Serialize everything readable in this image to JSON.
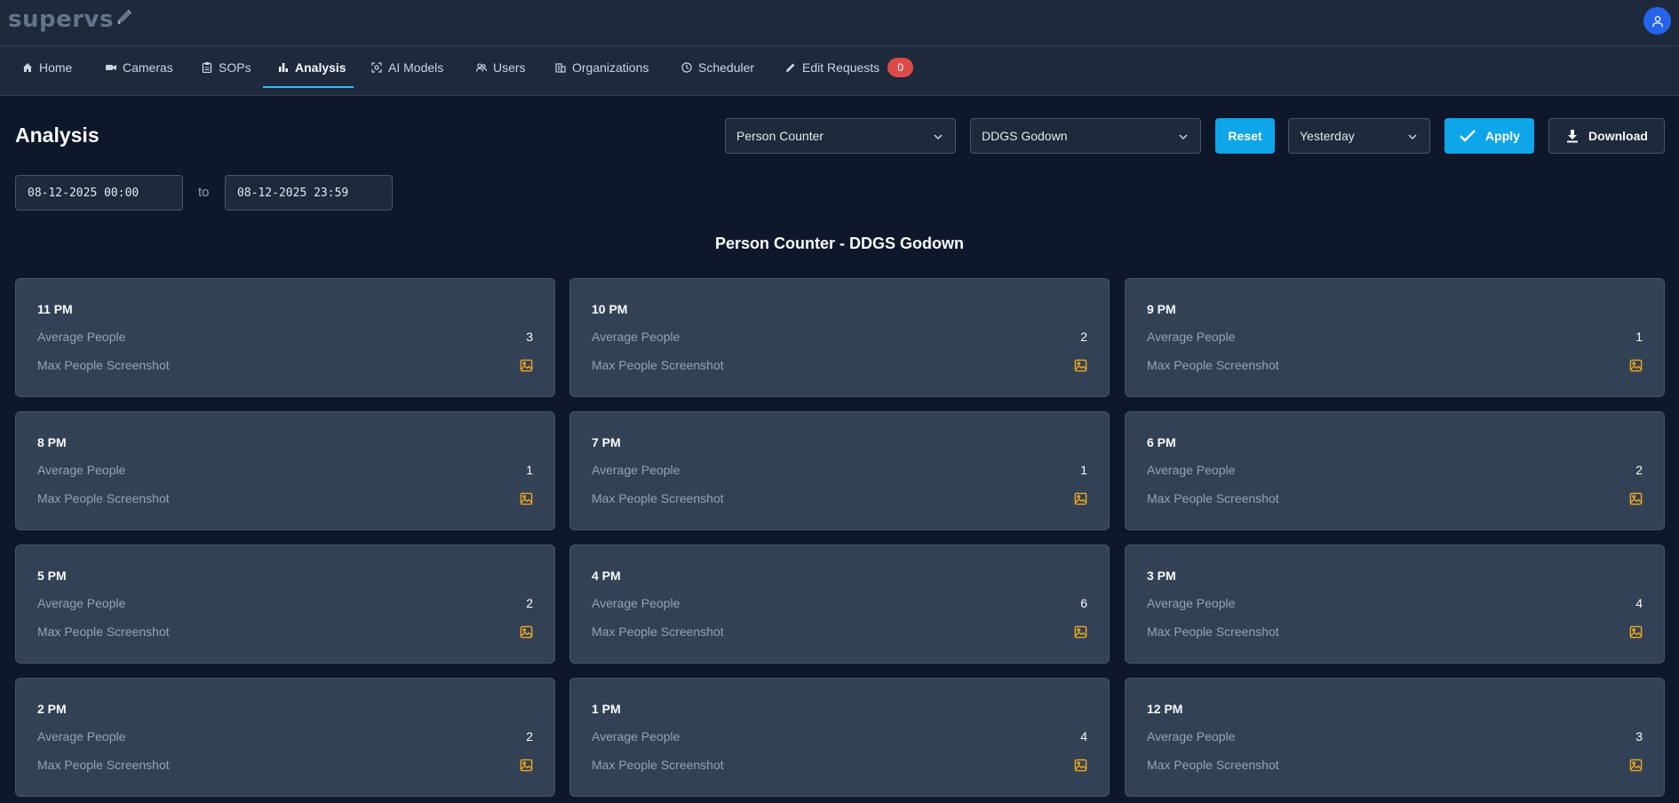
{
  "app": {
    "logo_text": "supervs"
  },
  "nav": {
    "items": [
      {
        "label": "Home",
        "icon": "home-icon"
      },
      {
        "label": "Cameras",
        "icon": "video-camera-icon"
      },
      {
        "label": "SOPs",
        "icon": "clipboard-icon"
      },
      {
        "label": "Analysis",
        "icon": "bar-chart-icon",
        "active": true
      },
      {
        "label": "AI Models",
        "icon": "scan-icon"
      },
      {
        "label": "Users",
        "icon": "users-icon"
      },
      {
        "label": "Organizations",
        "icon": "building-icon"
      },
      {
        "label": "Scheduler",
        "icon": "clock-icon"
      },
      {
        "label": "Edit Requests",
        "icon": "pencil-icon",
        "badge": "0"
      }
    ]
  },
  "page": {
    "title": "Analysis",
    "report_title": "Person Counter - DDGS Godown"
  },
  "filters": {
    "model_select": "Person Counter",
    "location_select": "DDGS Godown",
    "reset_label": "Reset",
    "range_select": "Yesterday",
    "apply_label": "Apply",
    "download_label": "Download",
    "date_from": "08-12-2025 00:00",
    "date_to": "08-12-2025 23:59",
    "to_label": "to"
  },
  "card_labels": {
    "average": "Average People",
    "screenshot": "Max People Screenshot"
  },
  "cards": [
    {
      "hour": "11 PM",
      "average": "3"
    },
    {
      "hour": "10 PM",
      "average": "2"
    },
    {
      "hour": "9 PM",
      "average": "1"
    },
    {
      "hour": "8 PM",
      "average": "1"
    },
    {
      "hour": "7 PM",
      "average": "1"
    },
    {
      "hour": "6 PM",
      "average": "2"
    },
    {
      "hour": "5 PM",
      "average": "2"
    },
    {
      "hour": "4 PM",
      "average": "6"
    },
    {
      "hour": "3 PM",
      "average": "4"
    },
    {
      "hour": "2 PM",
      "average": "2"
    },
    {
      "hour": "1 PM",
      "average": "4"
    },
    {
      "hour": "12 PM",
      "average": "3"
    }
  ],
  "colors": {
    "background": "#0f172a",
    "surface": "#1e293b",
    "card": "#334155",
    "accent": "#0ea5e9",
    "badge": "#dc4a4a",
    "image_icon": "#f0a91e",
    "avatar": "#2563eb"
  }
}
